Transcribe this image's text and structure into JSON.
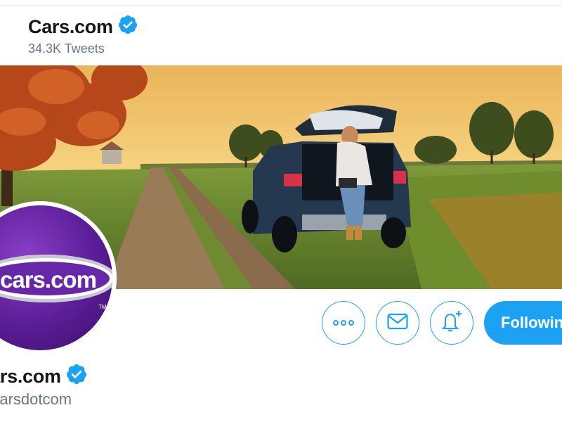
{
  "header": {
    "name": "Cars.com",
    "tweet_count": "34.3K Tweets",
    "verified_icon": "verified-badge-icon"
  },
  "banner": {
    "description_icon": "banner-image"
  },
  "avatar": {
    "logo_text": "cars.com",
    "trademark": "TM"
  },
  "actions": {
    "more_icon": "more-icon",
    "message_icon": "envelope-icon",
    "notify_icon": "bell-plus-icon",
    "following_label": "Following"
  },
  "profile": {
    "name": "Cars.com",
    "handle": "@carsdotcom"
  },
  "colors": {
    "accent": "#1da1f2",
    "text_secondary": "#657786",
    "avatar_purple": "#5a1d95"
  }
}
